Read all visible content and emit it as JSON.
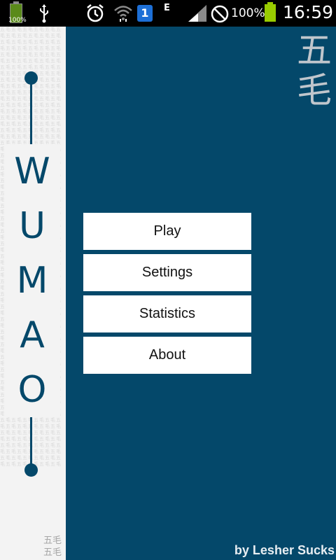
{
  "status_bar": {
    "left_battery_label": "100%",
    "network_type": "E",
    "sim_slot": "1",
    "battery_percent": "100%",
    "time": "16:59"
  },
  "left_strip": {
    "pattern_text": "五毛五毛五毛五毛五毛五毛五毛五毛五毛五毛五毛五毛五毛五毛五毛五毛五毛五毛五毛五毛五毛五毛五毛五毛五毛五毛五毛五毛五毛五毛五毛五毛五毛五毛五毛五毛五毛五毛五毛五毛五毛五毛五毛五毛五毛五毛五毛五毛五毛五毛五毛五毛五毛五毛五毛五毛五毛五毛五毛五毛五毛五毛五毛五毛五毛五毛五毛五毛五毛五毛五毛五毛五毛五毛五毛五毛五毛五毛五毛五毛五毛五毛五毛五毛五毛五毛五毛五毛五毛五毛五毛五毛五毛五毛五毛五毛五毛五毛五毛五毛五毛五毛五毛五毛五毛五毛五毛五毛五毛五毛五毛五毛五毛五毛五毛五毛五毛五毛五毛五毛五毛五毛五毛五毛五毛五毛五毛五毛五毛五毛五毛五毛五毛五毛五毛五毛五毛五毛五毛五毛五毛五毛五毛五毛五毛五毛五毛五毛五毛五毛五毛五毛五毛五毛五毛五毛五毛五毛五毛五毛五毛五毛五毛五毛五毛五毛五毛五毛五毛五毛五毛五毛五毛五毛五毛五毛五毛五毛五毛五毛五毛五毛五毛五毛五毛五毛五毛五毛五毛五毛五毛五毛五毛五毛五毛五毛五毛五毛五毛五毛五毛五毛五毛五毛五毛五毛五毛五毛五毛五毛五毛五毛五毛五毛五毛五毛五毛五毛五毛五毛五毛五毛五毛五毛五毛五毛五毛五毛五毛五毛五毛五毛五毛五毛五毛五毛五毛五毛五毛五毛五毛五毛五毛五毛五毛五毛五毛五毛五毛五毛五毛五毛五毛五毛五毛五毛五毛五毛五毛五毛五毛五毛五毛五毛五毛五毛五毛五毛五毛五毛五毛五毛五毛五毛五毛五毛五毛五毛五毛五毛五毛五毛五毛五毛五毛五毛五毛五毛五毛五毛五毛五毛五毛五毛五毛五毛五毛五毛五毛五毛五毛五毛五毛五毛五毛五毛五毛五毛五毛五毛五毛五毛五毛五毛五毛五毛五毛五毛五毛五毛五毛五毛五毛五毛五毛五毛五毛五毛五毛五毛五毛五毛五毛五毛五毛五毛五毛五毛五毛五毛五毛五毛五毛五毛五毛五毛五毛五毛五毛五毛五毛五毛五毛五毛五毛五毛五毛五毛五毛五毛五毛五毛五毛五毛五毛五毛五毛五毛五毛五毛五毛五毛五毛五毛五毛五毛五毛五毛五毛五毛五毛五毛五毛五毛五毛",
    "letters": [
      "W",
      "U",
      "M",
      "A",
      "O"
    ],
    "tag_line1": "五毛",
    "tag_line2": "五毛"
  },
  "brand": {
    "char1": "五",
    "char2": "毛"
  },
  "menu": {
    "play": "Play",
    "settings": "Settings",
    "statistics": "Statistics",
    "about": "About"
  },
  "credit": "by Lesher Sucks",
  "colors": {
    "background": "#04486a",
    "strip": "#f3f3f3",
    "button": "#ffffff",
    "status_bar": "#000000"
  },
  "icons": [
    "battery-icon",
    "usb-icon",
    "alarm-icon",
    "wifi-icon",
    "sim-icon",
    "signal-icon",
    "no-sign-icon",
    "battery-icon"
  ]
}
